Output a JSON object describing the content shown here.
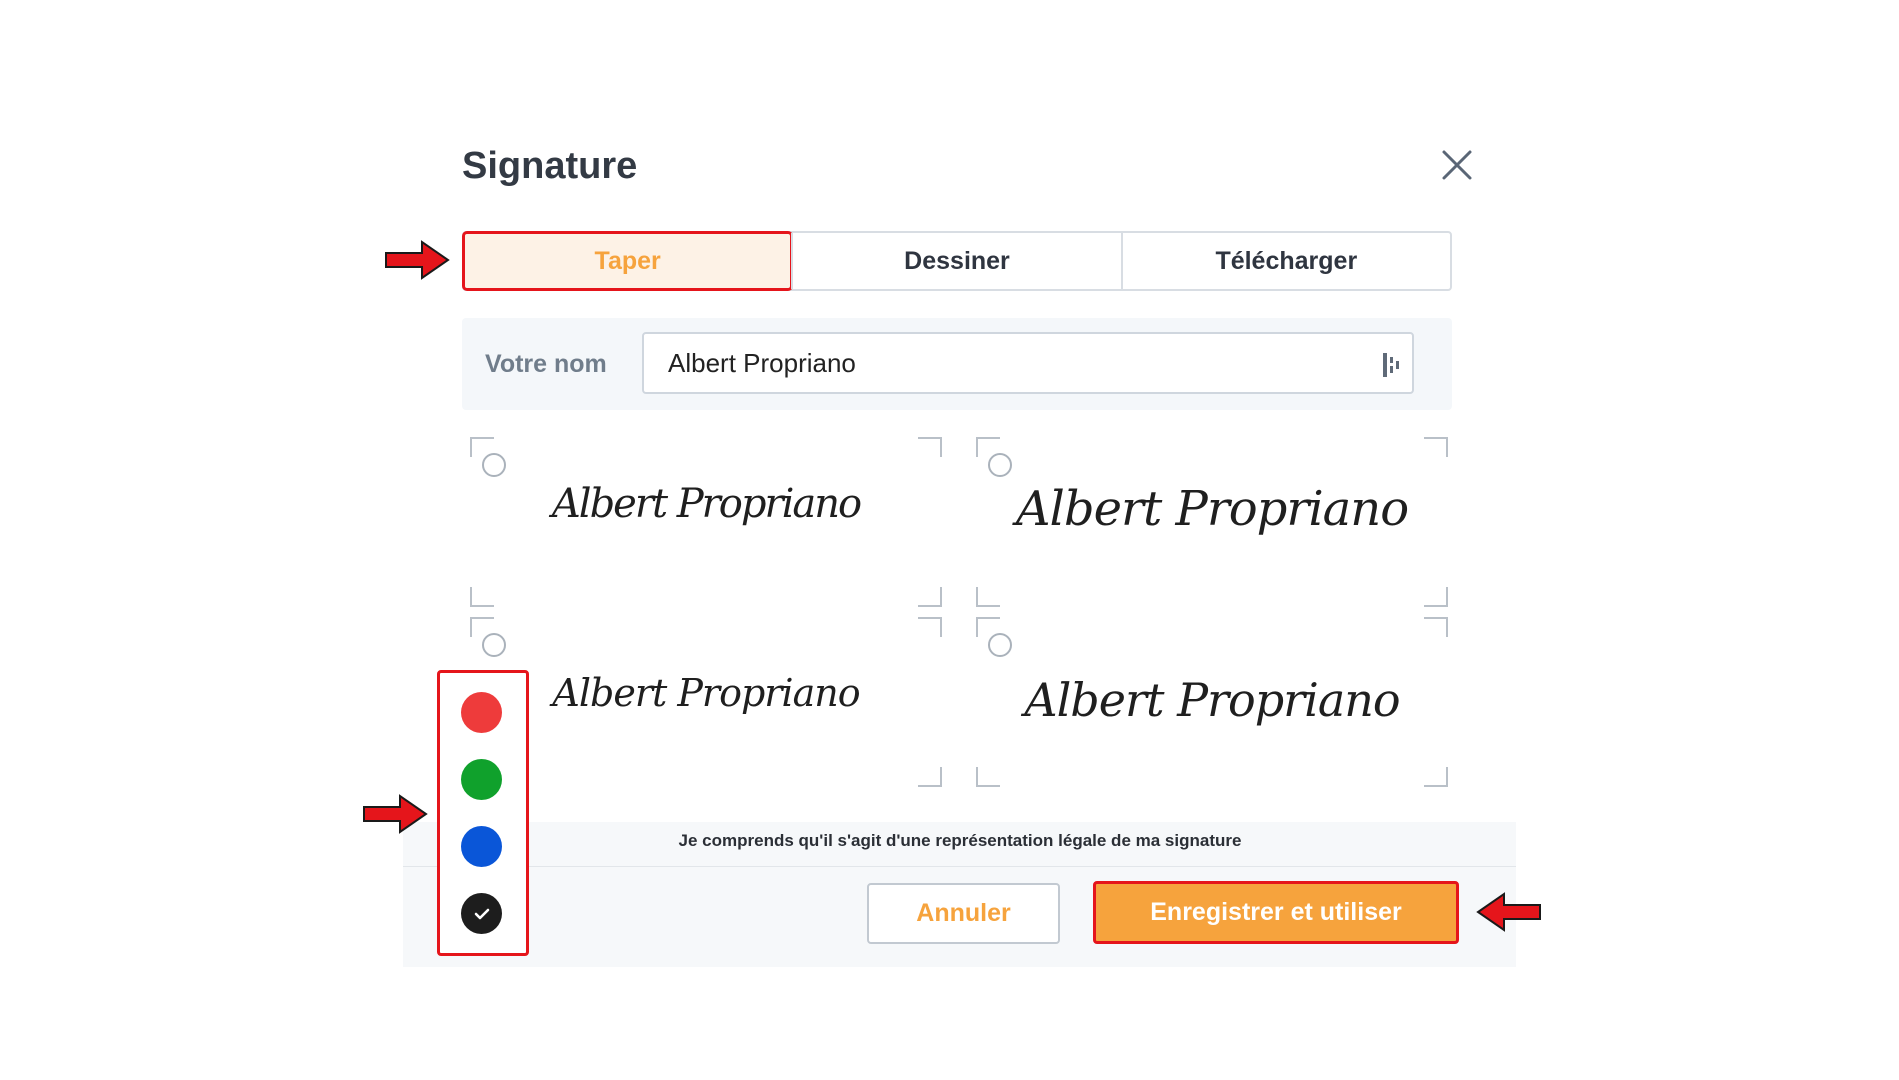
{
  "dialog": {
    "title": "Signature",
    "close_icon": "close-icon"
  },
  "tabs": [
    {
      "label": "Taper",
      "active": true
    },
    {
      "label": "Dessiner",
      "active": false
    },
    {
      "label": "Télécharger",
      "active": false
    }
  ],
  "name_field": {
    "label": "Votre nom",
    "value": "Albert Propriano",
    "icon": "password-manager-icon"
  },
  "signatures": [
    {
      "text": "Albert Propriano",
      "selected": false
    },
    {
      "text": "Albert Propriano",
      "selected": false
    },
    {
      "text": "Albert Propriano",
      "selected": false
    },
    {
      "text": "Albert Propriano",
      "selected": false
    }
  ],
  "colors": [
    {
      "name": "red",
      "hex": "#ee3b3b",
      "selected": false
    },
    {
      "name": "green",
      "hex": "#10a12c",
      "selected": false
    },
    {
      "name": "blue",
      "hex": "#0a56d8",
      "selected": false
    },
    {
      "name": "black",
      "hex": "#1d1d1d",
      "selected": true
    }
  ],
  "footer": {
    "legal_text": "Je comprends qu'il s'agit d'une représentation légale de ma signature",
    "cancel_label": "Annuler",
    "save_label": "Enregistrer et utiliser"
  },
  "theme": {
    "accent": "#f6a33d",
    "highlight": "#e5151b"
  }
}
